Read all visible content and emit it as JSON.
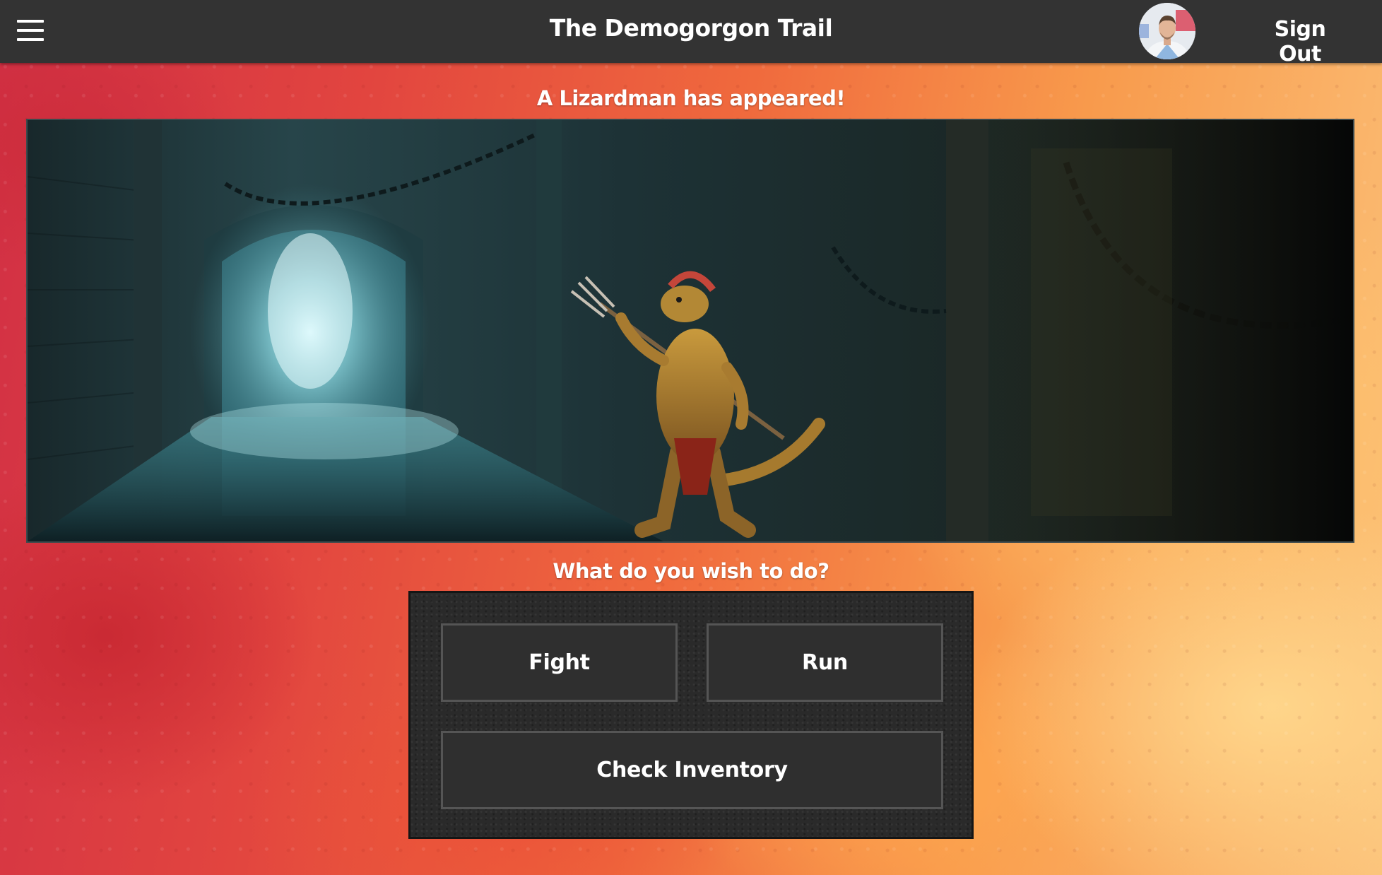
{
  "header": {
    "title": "The Demogorgon Trail",
    "menu_icon": "hamburger-menu-icon",
    "avatar_icon": "user-avatar",
    "sign_out_label": "Sign Out"
  },
  "encounter": {
    "message": "A Lizardman has appeared!",
    "scene_image": "lizardman-in-dungeon-corridor"
  },
  "actions": {
    "prompt": "What do you wish to do?",
    "fight_label": "Fight",
    "run_label": "Run",
    "inventory_label": "Check Inventory"
  },
  "colors": {
    "header_bg": "#333333",
    "button_bg": "#2f2f2f",
    "button_border": "#555555",
    "background_hot": "#d12f45",
    "background_warm": "#fbc27a"
  }
}
